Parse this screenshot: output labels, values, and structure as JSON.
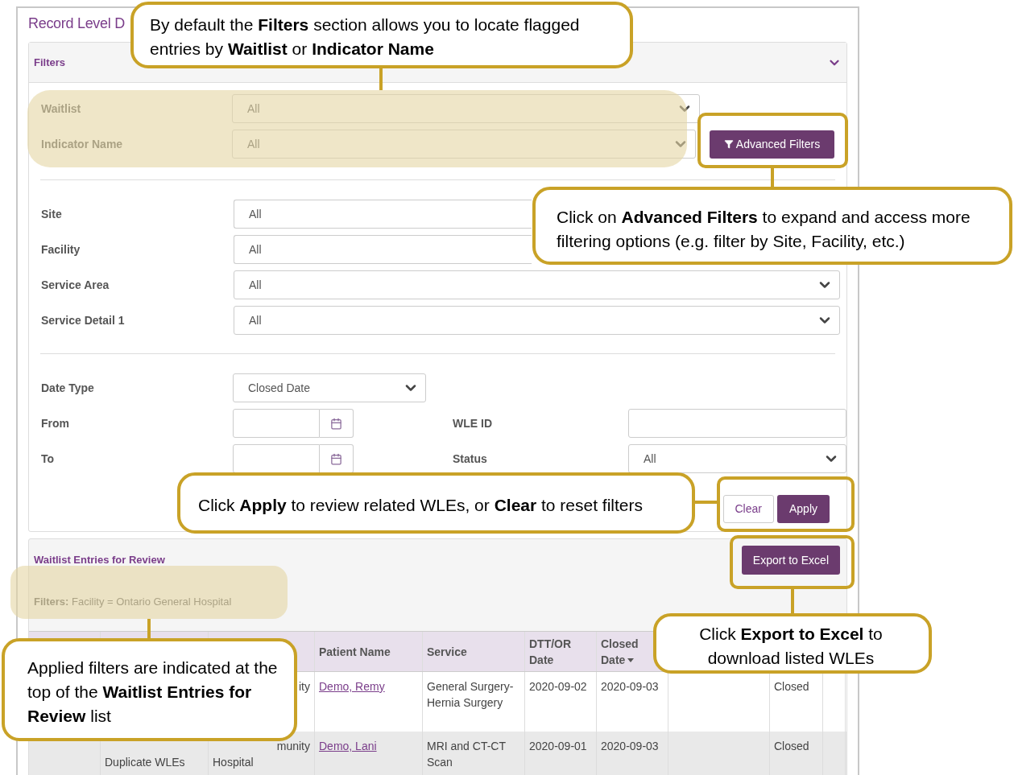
{
  "page_title": "Record Level D",
  "filters_panel": {
    "title": "Filters",
    "expanded": true,
    "basic_filters": [
      {
        "label": "Waitlist",
        "value": "All"
      },
      {
        "label": "Indicator Name",
        "value": "All"
      }
    ],
    "advanced_button": "Advanced Filters",
    "advanced_filters": [
      {
        "label": "Site",
        "value": "All"
      },
      {
        "label": "Facility",
        "value": "All"
      },
      {
        "label": "Service Area",
        "value": "All"
      },
      {
        "label": "Service Detail 1",
        "value": "All"
      }
    ],
    "date_type": {
      "label": "Date Type",
      "value": "Closed Date"
    },
    "from": {
      "label": "From"
    },
    "to": {
      "label": "To"
    },
    "wle_id": {
      "label": "WLE ID"
    },
    "status": {
      "label": "Status",
      "value": "All"
    },
    "buttons": [
      "Clear",
      "Apply"
    ]
  },
  "results_panel": {
    "title": "Waitlist Entries for Review",
    "export_button": "Export to Excel",
    "applied_filters": {
      "label": "Filters:",
      "text": "Facility = Ontario General Hospital"
    },
    "table": {
      "columns": [
        {},
        {},
        {},
        {
          "label": "Patient Name"
        },
        {
          "label": "Service"
        },
        {
          "label": "DTT/OR Date"
        },
        {
          "label": "Closed Date",
          "sorted": true
        },
        {},
        {},
        {}
      ],
      "rows": [
        {
          "cells": [
            null,
            null,
            {
              "lines": [
                "ity"
              ],
              "covered_left": true
            },
            {
              "lines": [
                "Demo, Remy"
              ],
              "link": true
            },
            {
              "lines": [
                "General Surgery-",
                "Hernia Surgery"
              ]
            },
            {
              "lines": [
                "2020-09-02"
              ]
            },
            {
              "lines": [
                "2020-09-03"
              ]
            },
            null,
            {
              "lines": [
                "Closed"
              ]
            },
            null
          ]
        },
        {
          "cells": [
            null,
            {
              "lines": [
                "Duplicate WLEs"
              ],
              "covered_above": true
            },
            {
              "lines": [
                "munity",
                "Hospital"
              ],
              "covered_left": true
            },
            {
              "lines": [
                "Demo, Lani"
              ],
              "link": true
            },
            {
              "lines": [
                "MRI and CT-CT",
                "Scan"
              ]
            },
            {
              "lines": [
                "2020-09-01"
              ]
            },
            {
              "lines": [
                "2020-09-03"
              ]
            },
            null,
            {
              "lines": [
                "Closed"
              ]
            },
            null
          ]
        }
      ]
    }
  },
  "callouts": [
    {
      "text": "By default the **Filters** section allows you to locate flagged entries by **Waitlist** or **Indicator Name**"
    },
    {
      "text": "Click on **Advanced Filters** to expand and access more filtering options (e.g. filter by Site, Facility, etc.)"
    },
    {
      "text": "Click **Apply** to review related WLEs, or **Clear** to reset filters"
    },
    {
      "text": "Click **Export to Excel** to download listed WLEs"
    },
    {
      "text": "Applied filters are indicated at the top of the **Waitlist Entries for Review** list"
    }
  ]
}
